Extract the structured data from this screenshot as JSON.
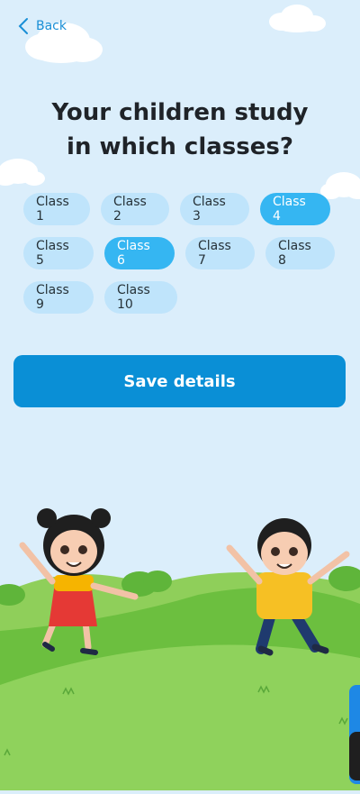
{
  "header": {
    "back_label": "Back"
  },
  "title": {
    "line1": "Your children study",
    "line2": "in which classes?"
  },
  "classes": [
    {
      "label": "Class 1",
      "selected": false
    },
    {
      "label": "Class 2",
      "selected": false
    },
    {
      "label": "Class 3",
      "selected": false
    },
    {
      "label": "Class 4",
      "selected": true
    },
    {
      "label": "Class 5",
      "selected": false
    },
    {
      "label": "Class 6",
      "selected": true
    },
    {
      "label": "Class 7",
      "selected": false
    },
    {
      "label": "Class 8",
      "selected": false
    },
    {
      "label": "Class 9",
      "selected": false
    },
    {
      "label": "Class 10",
      "selected": false
    }
  ],
  "actions": {
    "save_label": "Save details"
  },
  "colors": {
    "accent": "#0a8fd6",
    "chip": "#bfe4fb",
    "chip_selected": "#35b6f2",
    "sky": "#dbeefb",
    "grass": "#6cbf3f"
  },
  "illustration": {
    "left_figure": "girl-jumping",
    "right_figure": "boy-jumping"
  }
}
